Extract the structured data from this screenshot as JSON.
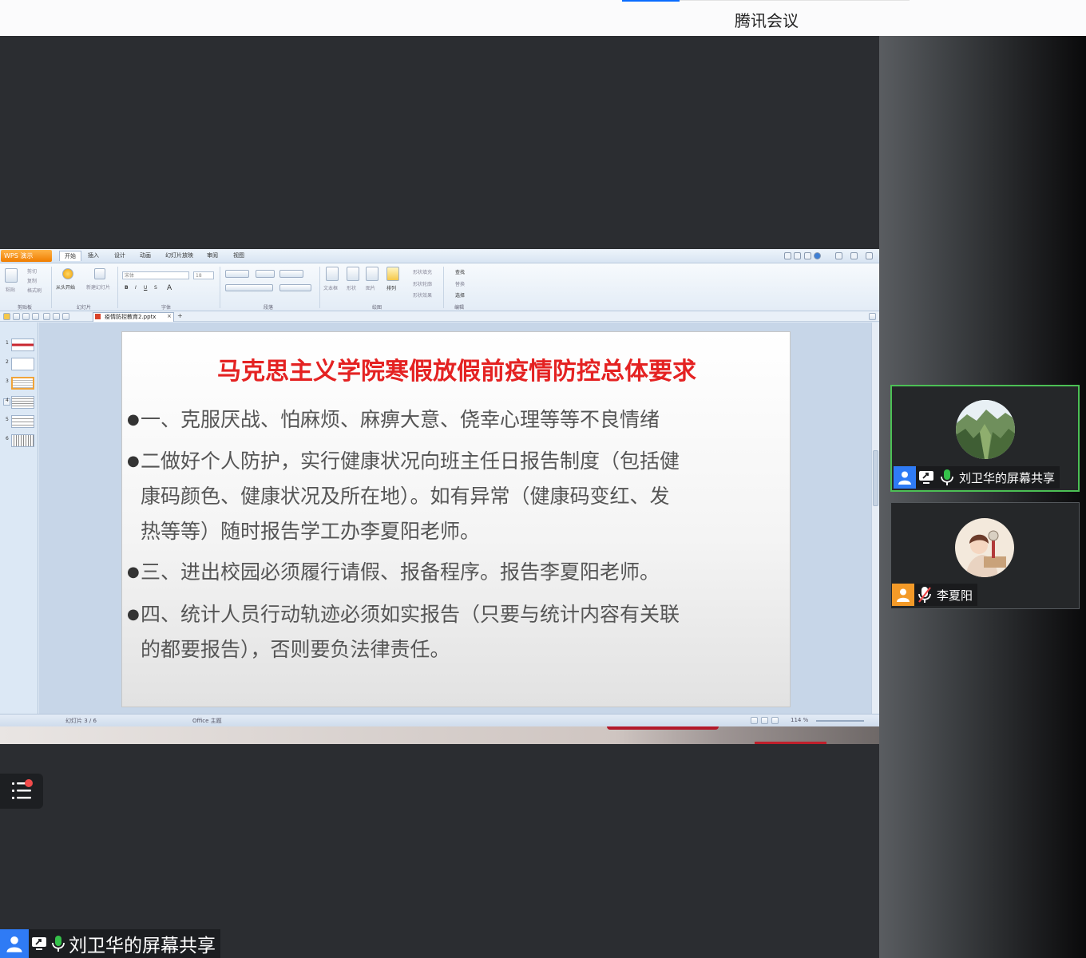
{
  "app": {
    "title": "腾讯会议"
  },
  "wps": {
    "logo": "WPS 演示",
    "tabs": [
      "开始",
      "插入",
      "设计",
      "动画",
      "幻灯片放映",
      "审阅",
      "视图"
    ],
    "ribbon": {
      "paste": "粘贴",
      "cut": "剪切",
      "copy": "复制",
      "format_painter": "格式刷",
      "play_from_start": "从头开始",
      "new_slide": "新建幻灯片",
      "font_name": "宋体",
      "font_size": "18",
      "textbox": "文本框",
      "shape": "形状",
      "picture": "图片",
      "arrange": "排列",
      "fill": "形状填充",
      "outline": "形状轮廓",
      "effect": "形状效果",
      "find": "查找",
      "replace": "替换",
      "select": "选择",
      "groups": [
        "剪贴板",
        "幻灯片",
        "字体",
        "段落",
        "绘图",
        "编辑"
      ]
    },
    "doc_tab": "疫情防控教育2.pptx",
    "status": {
      "slide_count": "幻灯片 3 / 6",
      "theme": "Office 主题",
      "zoom": "114 %"
    }
  },
  "slide": {
    "title": "马克思主义学院寒假放假前疫情防控总体要求",
    "bullets": [
      {
        "line1": "一、克服厌战、怕麻烦、麻痹大意、侥幸心理等等不良情绪",
        "rest": []
      },
      {
        "line1": "二做好个人防护，实行健康状况向班主任日报告制度（包括健",
        "rest": [
          "康码颜色、健康状况及所在地）。如有异常（健康码变红、发",
          "热等等）随时报告学工办李夏阳老师。"
        ]
      },
      {
        "line1": "三、进出校园必须履行请假、报备程序。报告李夏阳老师。",
        "rest": []
      },
      {
        "line1": "四、统计人员行动轨迹必须如实报告（只要与统计内容有关联",
        "rest": [
          "的都要报告），否则要负法律责任。"
        ]
      }
    ],
    "bullet_symbol": "●"
  },
  "participants": [
    {
      "name": "刘卫华的屏幕共享",
      "mic": "on",
      "sharing": true,
      "active": true,
      "avatar": "mountain-landscape"
    },
    {
      "name": "李夏阳",
      "mic": "muted",
      "sharing": false,
      "active": false,
      "avatar": "illustrated-girl"
    }
  ],
  "presenter_label": "刘卫华的屏幕共享",
  "colors": {
    "active_border": "#4cc055",
    "person_icon_blue": "#2f7bf5",
    "person_icon_orange": "#f39a28",
    "mic_green": "#35c14a",
    "title_red": "#e42222"
  }
}
